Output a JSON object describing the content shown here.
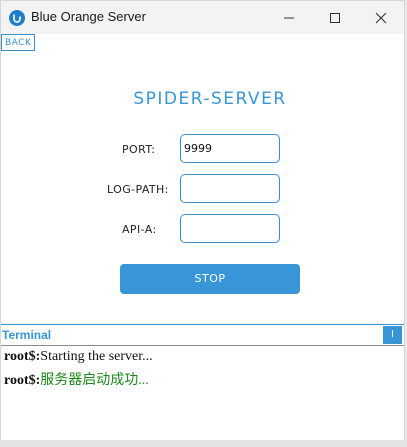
{
  "window": {
    "title": "Blue Orange Server",
    "icon": "app-logo-icon",
    "controls": [
      "minimize-icon",
      "maximize-icon",
      "close-icon"
    ]
  },
  "nav": {
    "back_label": "BACK"
  },
  "main": {
    "title": "SPIDER-SERVER",
    "fields": {
      "port": {
        "label": "PORT:",
        "value": "9999"
      },
      "log_path": {
        "label": "LOG-PATH:",
        "value": ""
      },
      "api_a": {
        "label": "API-A:",
        "value": ""
      }
    },
    "stop_label": "STOP"
  },
  "terminal": {
    "title": "Terminal",
    "corner_label": "I",
    "lines": [
      {
        "prompt": "root$:",
        "text": "Starting the server..."
      },
      {
        "prompt": "root$:",
        "text": "服务器启动成功..."
      }
    ]
  },
  "colors": {
    "accent": "#3896d8",
    "success_text": "#1a8a1a"
  }
}
